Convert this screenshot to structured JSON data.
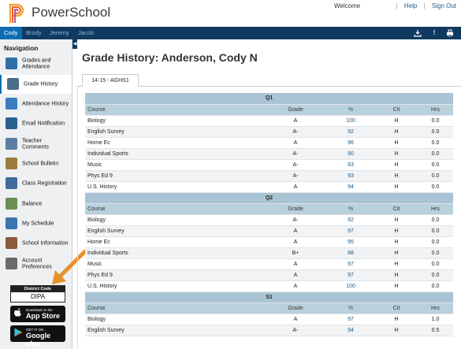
{
  "header": {
    "brand": "PowerSchool",
    "welcome": "Welcome",
    "help": "Help",
    "sign_out": "Sign Out"
  },
  "students": [
    {
      "name": "Cody",
      "active": true
    },
    {
      "name": "Brody",
      "active": false
    },
    {
      "name": "Jeremy",
      "active": false
    },
    {
      "name": "Jacob",
      "active": false
    }
  ],
  "toolbar_icons": [
    "download-icon",
    "alert-icon",
    "printer-icon"
  ],
  "sidebar": {
    "title": "Navigation",
    "items": [
      {
        "label": "Grades and Attendance",
        "icon": "grades-icon",
        "color": "#2f6fa8"
      },
      {
        "label": "Grade History",
        "icon": "grade-history-icon",
        "color": "#4a6d8c",
        "active": true
      },
      {
        "label": "Attendance History",
        "icon": "attendance-icon",
        "color": "#3b7dbf"
      },
      {
        "label": "Email Notification",
        "icon": "email-icon",
        "color": "#2b5f8e"
      },
      {
        "label": "Teacher Comments",
        "icon": "comments-icon",
        "color": "#5a7fa0"
      },
      {
        "label": "School Bulletin",
        "icon": "bulletin-icon",
        "color": "#9c7b3a"
      },
      {
        "label": "Class Registration",
        "icon": "registration-icon",
        "color": "#3f6c9a"
      },
      {
        "label": "Balance",
        "icon": "balance-icon",
        "color": "#6b8f4e"
      },
      {
        "label": "My Schedule",
        "icon": "schedule-icon",
        "color": "#3a76b0"
      },
      {
        "label": "School Information",
        "icon": "school-icon",
        "color": "#8a5a3a"
      },
      {
        "label": "Account Preferences",
        "icon": "preferences-icon",
        "color": "#6a6a6a"
      }
    ]
  },
  "district_code": {
    "label": "District Code",
    "value": "DIPA"
  },
  "stores": [
    {
      "small": "Download on the",
      "big": "App Store",
      "icon": "apple-icon"
    },
    {
      "small": "GET IT ON",
      "big": "Google play",
      "icon": "google-play-icon"
    }
  ],
  "main": {
    "title": "Grade History: Anderson, Cody N",
    "tab": "14-15 - AGHS1"
  },
  "columns": [
    "Course",
    "Grade",
    "%",
    "Cit",
    "Hrs"
  ],
  "terms": [
    {
      "name": "Q1",
      "rows": [
        {
          "course": "Biology",
          "grade": "A",
          "pct": "100",
          "cit": "H",
          "hrs": "0.0"
        },
        {
          "course": "English Survey",
          "grade": "A-",
          "pct": "92",
          "cit": "H",
          "hrs": "0.0"
        },
        {
          "course": "Home Ec",
          "grade": "A",
          "pct": "96",
          "cit": "H",
          "hrs": "0.0"
        },
        {
          "course": "Individual Sports",
          "grade": "A-",
          "pct": "90",
          "cit": "H",
          "hrs": "0.0"
        },
        {
          "course": "Music",
          "grade": "A-",
          "pct": "93",
          "cit": "H",
          "hrs": "0.0"
        },
        {
          "course": "Phys Ed 9",
          "grade": "A-",
          "pct": "93",
          "cit": "H",
          "hrs": "0.0"
        },
        {
          "course": "U.S. History",
          "grade": "A",
          "pct": "94",
          "cit": "H",
          "hrs": "0.0"
        }
      ]
    },
    {
      "name": "Q2",
      "rows": [
        {
          "course": "Biology",
          "grade": "A-",
          "pct": "92",
          "cit": "H",
          "hrs": "0.0"
        },
        {
          "course": "English Survey",
          "grade": "A",
          "pct": "97",
          "cit": "H",
          "hrs": "0.0"
        },
        {
          "course": "Home Ec",
          "grade": "A",
          "pct": "95",
          "cit": "H",
          "hrs": "0.0"
        },
        {
          "course": "Individual Sports",
          "grade": "B+",
          "pct": "88",
          "cit": "H",
          "hrs": "0.0"
        },
        {
          "course": "Music",
          "grade": "A",
          "pct": "97",
          "cit": "H",
          "hrs": "0.0"
        },
        {
          "course": "Phys Ed 9",
          "grade": "A",
          "pct": "97",
          "cit": "H",
          "hrs": "0.0"
        },
        {
          "course": "U.S. History",
          "grade": "A",
          "pct": "100",
          "cit": "H",
          "hrs": "0.0"
        }
      ]
    },
    {
      "name": "S1",
      "rows": [
        {
          "course": "Biology",
          "grade": "A",
          "pct": "97",
          "cit": "H",
          "hrs": "1.0"
        },
        {
          "course": "English Survey",
          "grade": "A-",
          "pct": "94",
          "cit": "H",
          "hrs": "0.5"
        }
      ]
    }
  ],
  "colors": {
    "topbar": "#113a60",
    "active_tab": "#0d6db3",
    "term_header": "#a9c4d4",
    "column_header": "#b9d0dd",
    "link": "#1a5a8a",
    "arrow": "#e8902a"
  }
}
